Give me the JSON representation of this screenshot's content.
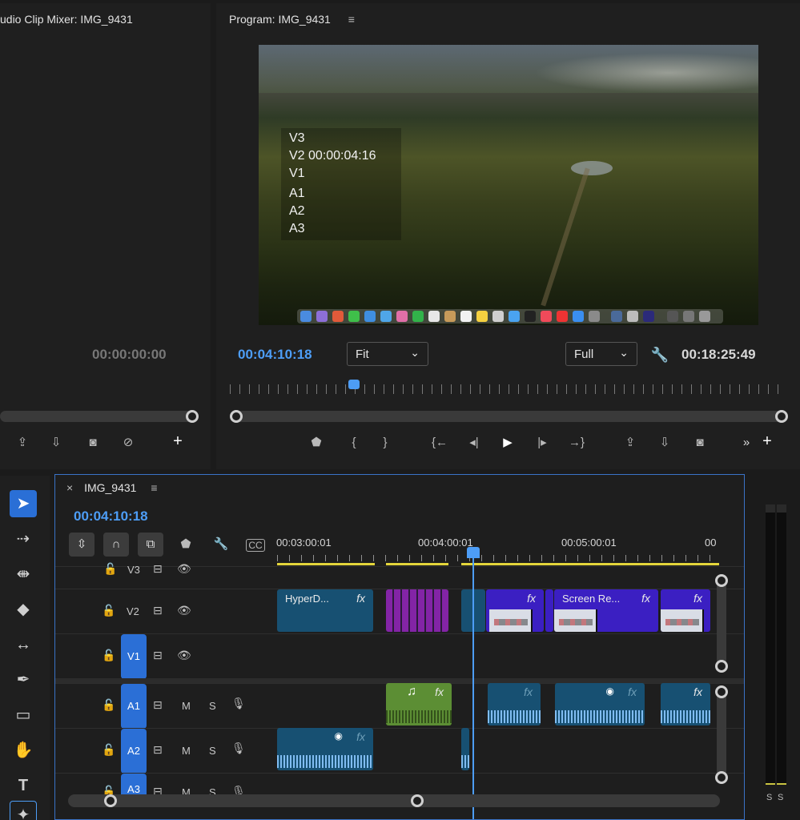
{
  "mixer": {
    "title": "udio Clip Mixer: IMG_9431",
    "timecode": "00:00:00:00"
  },
  "program": {
    "title": "Program: IMG_9431",
    "overlay_lines": [
      "V3",
      "V2 00:00:04:16",
      "V1",
      "A1",
      "A2",
      "A3"
    ],
    "current_timecode": "00:04:10:18",
    "fit_label": "Fit",
    "quality_label": "Full",
    "duration_timecode": "00:18:25:49"
  },
  "timeline": {
    "tab_label": "IMG_9431",
    "timecode": "00:04:10:18",
    "ruler_labels": [
      "00:03:00:01",
      "00:04:00:01",
      "00:05:00:01",
      "00"
    ],
    "tracks": {
      "v3": "V3",
      "v2": "V2",
      "v1": "V1",
      "a1": "A1",
      "a2": "A2",
      "a3": "A3",
      "mute": "M",
      "solo": "S"
    },
    "clips": {
      "hyperdeck": "HyperD...",
      "screen_re": "Screen Re...",
      "fx": "fx"
    }
  },
  "meters": {
    "labels": [
      "S",
      "S"
    ]
  }
}
